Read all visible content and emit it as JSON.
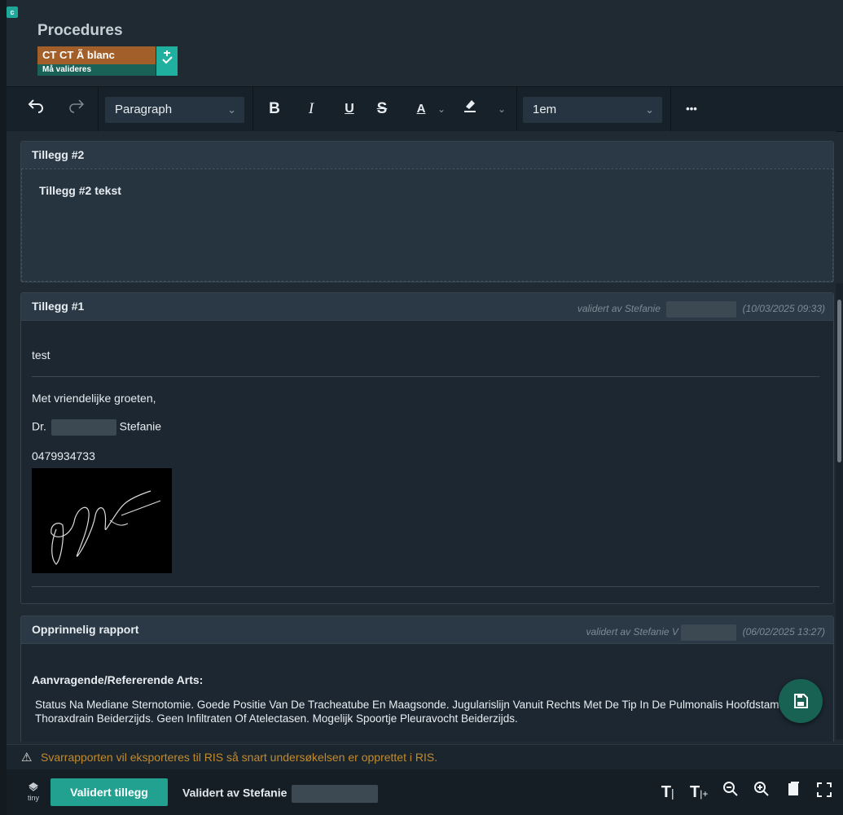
{
  "badge": "c",
  "procedure": {
    "title": "Procedures",
    "tag_name": "CT CT Ã  blanc",
    "tag_status": "Må valideres",
    "tag_icon": "validate-icon"
  },
  "toolbar": {
    "undo": "undo-icon",
    "redo": "redo-icon",
    "block_format": "Paragraph",
    "bold": "B",
    "italic": "I",
    "underline": "U",
    "strike": "S",
    "font_color": "A",
    "font_size": "1em",
    "more": "•••"
  },
  "addendum2": {
    "title": "Tillegg #2",
    "body": "Tillegg #2 tekst"
  },
  "addendum1": {
    "title": "Tillegg #1",
    "validated_label": "validert av Stefanie",
    "timestamp": "(10/03/2025 09:33)",
    "body": "test",
    "greeting": "Met vriendelijke groeten,",
    "doctor_prefix": "Dr.",
    "doctor_name": "Stefanie",
    "phone": "0479934733"
  },
  "original": {
    "title": "Opprinnelig rapport",
    "validated_label": "validert av Stefanie V",
    "timestamp": "(06/02/2025 13:27)",
    "section_label": "Aanvragende/Refererende Arts:",
    "text": "Status Na Mediane Sternotomie. Goede Positie Van De Tracheatube En Maagsonde. Jugularislijn Vanuit Rechts Met De Tip In De Pulmonalis Hoofdstam. Thoraxdrain Beiderzijds. Geen Infiltraten Of Atelectasen. Mogelijk Spoortje Pleuravocht Beiderzijds."
  },
  "warning": {
    "icon": "warning-icon",
    "text": "Svarrapporten vil eksporteres til RIS så snart undersøkelsen er opprettet i RIS."
  },
  "footer": {
    "logo": "tiny",
    "validate_button": "Validert tillegg",
    "validated_by_label": "Validert av",
    "validated_by_name": "Stefanie",
    "icons": [
      "text-decrease-icon",
      "text-increase-icon",
      "zoom-out-icon",
      "zoom-in-icon",
      "document-icon",
      "fullscreen-icon"
    ]
  },
  "colors": {
    "accent": "#22a191",
    "warning": "#c48a2a",
    "tag_orange": "#a35f2a",
    "tag_green": "#1a6258"
  }
}
